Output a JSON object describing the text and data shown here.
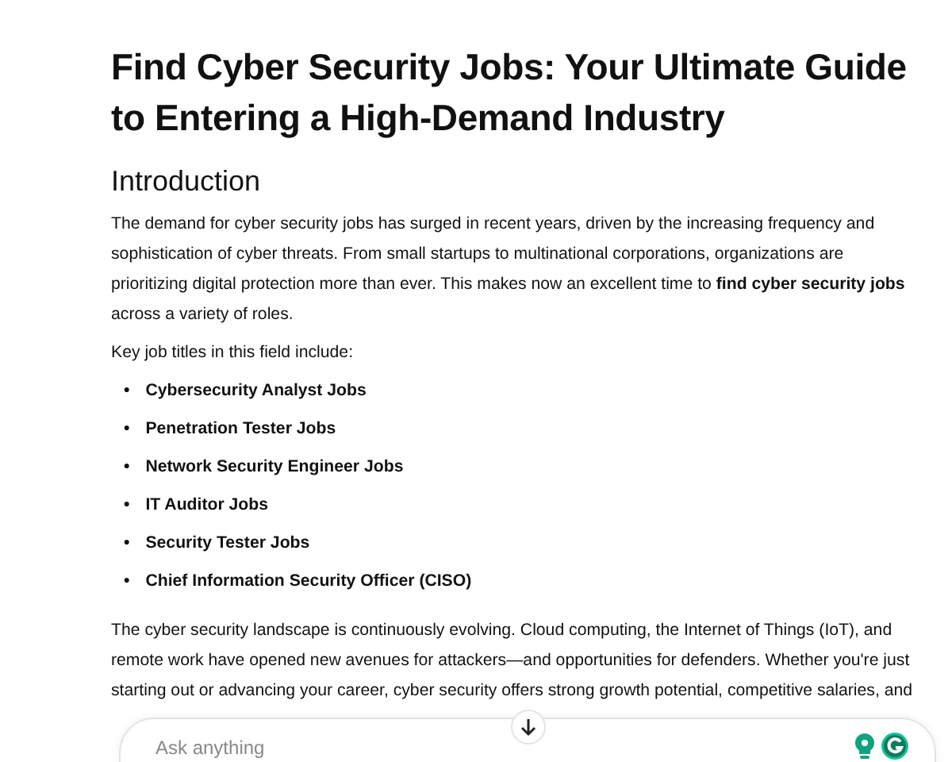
{
  "article": {
    "title": "Find Cyber Security Jobs: Your Ultimate Guide to Entering a High-Demand Industry",
    "section_heading": "Introduction",
    "intro": "The demand for cyber security jobs has surged in recent years, driven by the increasing frequency and sophistication of cyber threats. From small startups to multinational corporations, organizations are prioritizing digital protection more than ever. This makes now an excellent time to **find cyber security jobs** across a variety of roles.",
    "list_intro": "Key job titles in this field include:",
    "job_titles": [
      {
        "bullet": "•",
        "text": "Cybersecurity Analyst Jobs"
      },
      {
        "bullet": "•",
        "text": "Penetration Tester Jobs"
      },
      {
        "bullet": "•",
        "text": "Network Security Engineer Jobs"
      },
      {
        "bullet": "•",
        "text": "IT Auditor Jobs"
      },
      {
        "bullet": "•",
        "text": "Security Tester Jobs"
      },
      {
        "bullet": "•",
        "text": "Chief Information Security Officer (CISO)"
      }
    ],
    "closing": "The cyber security landscape is continuously evolving. Cloud computing, the Internet of Things (IoT), and remote work have opened new avenues for attackers—and opportunities for defenders. Whether you're just starting out or advancing your career, cyber security offers strong growth potential, competitive salaries, and"
  },
  "chat_input": {
    "placeholder": "Ask anything"
  }
}
